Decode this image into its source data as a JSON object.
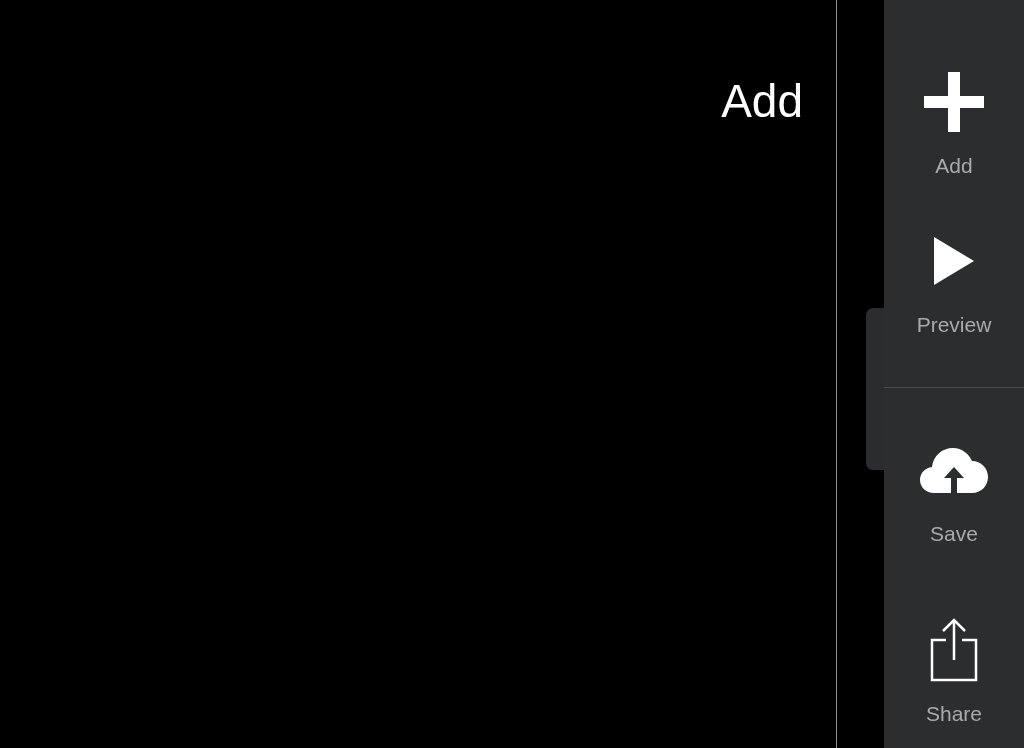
{
  "title": "Add",
  "toolbar_groups": [
    [
      {
        "kind": "add",
        "label": "Add"
      },
      {
        "kind": "preview",
        "label": "Preview"
      }
    ],
    [
      {
        "kind": "save",
        "label": "Save"
      },
      {
        "kind": "share",
        "label": "Share"
      }
    ]
  ]
}
